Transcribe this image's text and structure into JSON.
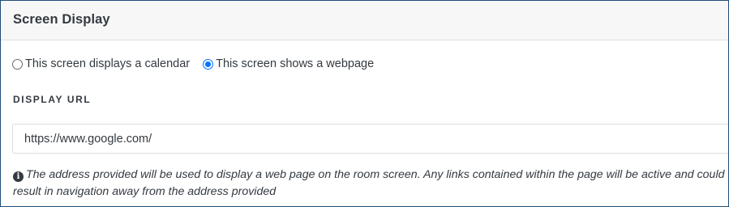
{
  "panel": {
    "title": "Screen Display"
  },
  "display_mode": {
    "options": [
      {
        "label": "This screen displays a calendar",
        "selected": false
      },
      {
        "label": "This screen shows a webpage",
        "selected": true
      }
    ]
  },
  "display_url": {
    "label": "DISPLAY URL",
    "value": "https://www.google.com/"
  },
  "help": {
    "icon": "info-circle-icon",
    "text": "The address provided will be used to display a web page on the room screen. Any links contained within the page will be active and could result in navigation away from the address provided"
  },
  "colors": {
    "accent": "#0075ff",
    "text": "#343a40",
    "header_bg": "#f7f7f7",
    "frame_border": "#1f4e79"
  }
}
